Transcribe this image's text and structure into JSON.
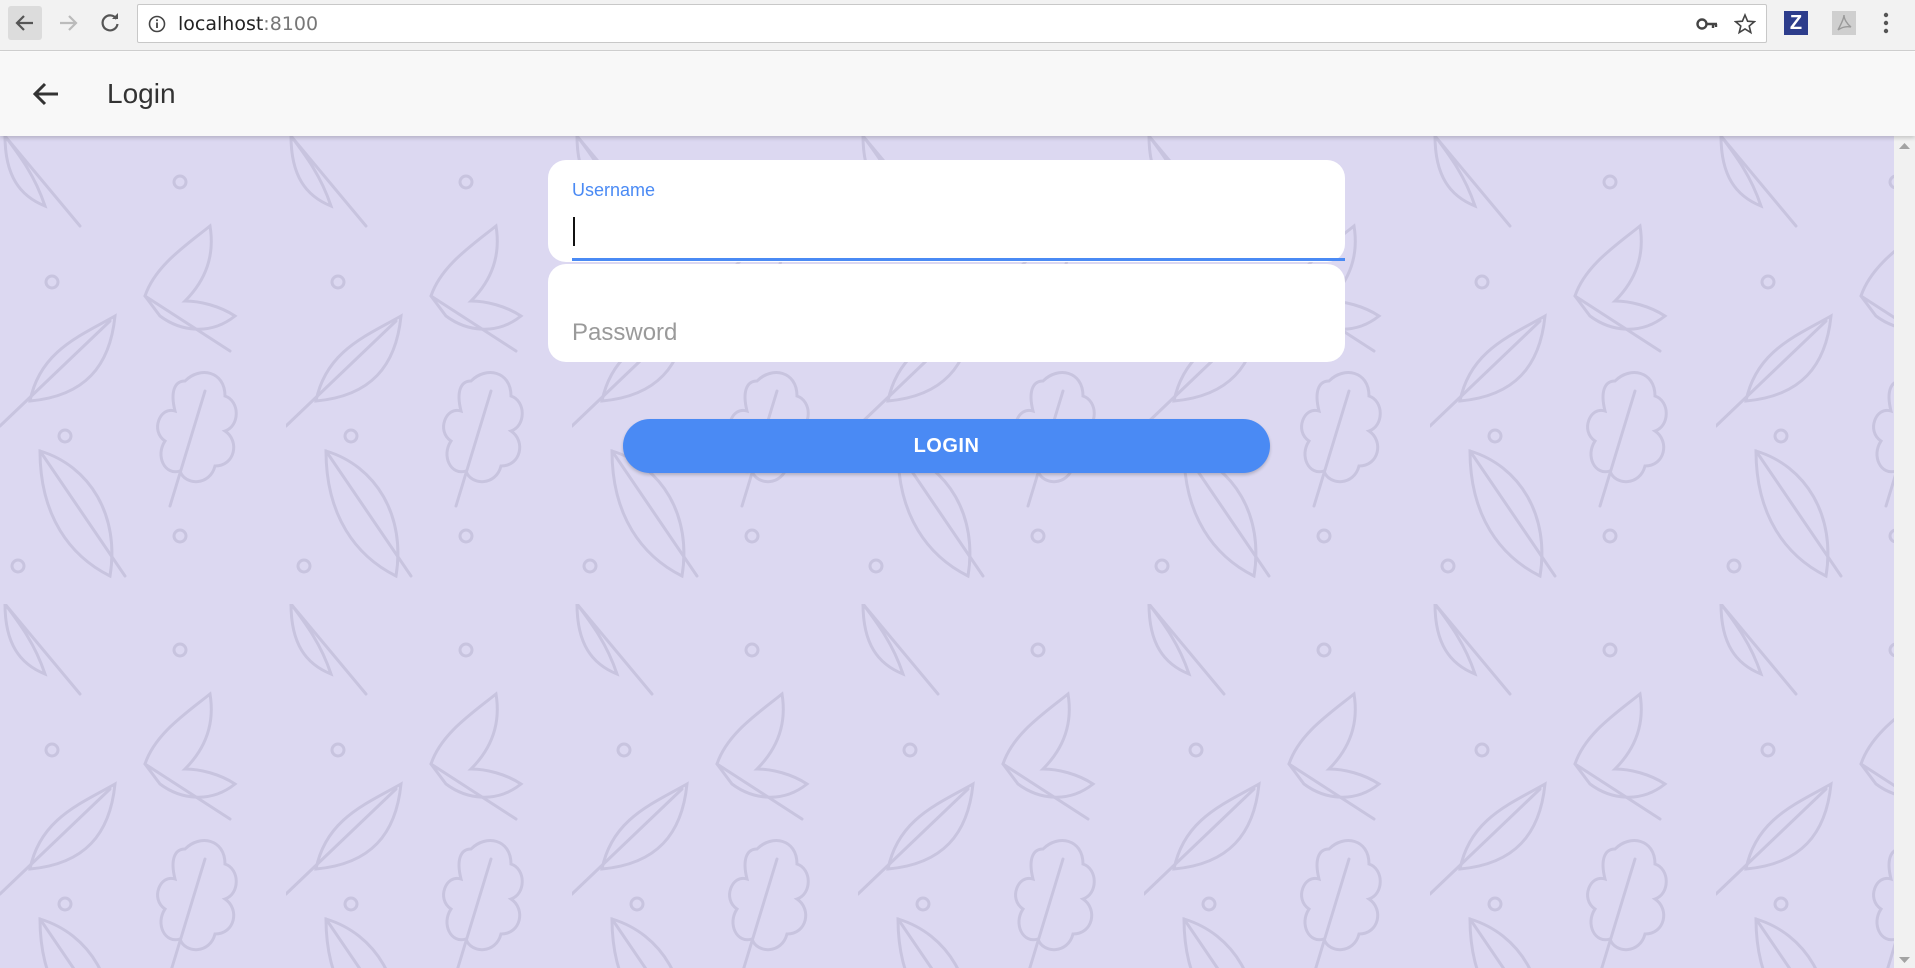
{
  "browser": {
    "url_host": "localhost",
    "url_port": ":8100",
    "icons": [
      "back-arrow-icon",
      "forward-arrow-icon",
      "reload-icon",
      "info-icon",
      "key-icon",
      "star-icon",
      "zotero-extension-icon",
      "pdf-extension-icon",
      "menu-dots-icon"
    ],
    "extension_z_label": "Z"
  },
  "header": {
    "title": "Login",
    "back_icon": "arrow-left-icon"
  },
  "form": {
    "username_label": "Username",
    "username_value": "",
    "password_placeholder": "Password",
    "login_label": "LOGIN"
  },
  "colors": {
    "accent": "#4a8af4",
    "background": "#dcd8f1",
    "leaf_pattern": "#c8c4df",
    "header_bg": "#f8f8f8"
  }
}
